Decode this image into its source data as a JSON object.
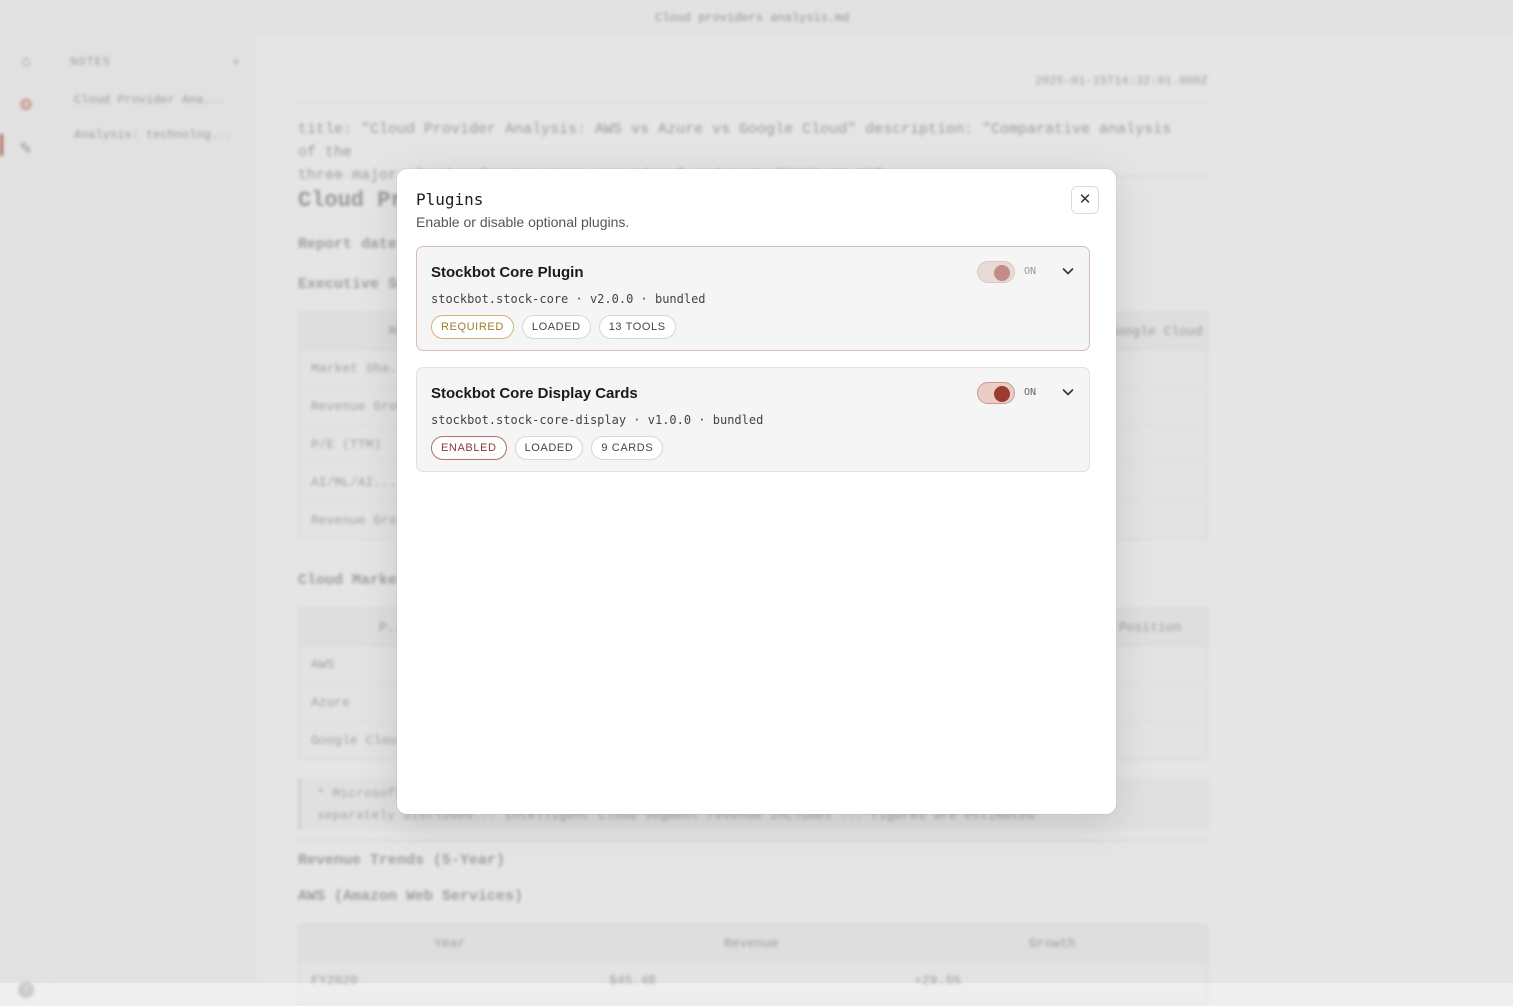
{
  "background": {
    "window_title": "Cloud providers analysis.md",
    "sidebar": {
      "header": "NOTES",
      "add_icon": "plus-icon",
      "items": [
        {
          "label": "Cloud Provider Ana..."
        },
        {
          "label": "Analysis: technolog..."
        }
      ]
    },
    "rail": {
      "icons": [
        "home-icon",
        "gear-icon",
        "wrench-icon"
      ],
      "help_icon": "help-icon"
    },
    "document": {
      "date": "2025-01-15T14:32:01.000Z",
      "meta_lines": [
        "title: \"Cloud Provider Analysis: AWS vs Azure vs Google Cloud\" description: \"Comparative analysis of the",
        "three major cloud infrastructure providers\" updated: \"2025-01-15\""
      ],
      "heading": "Cloud Pr...",
      "report_label": "Report date...",
      "section_exec": "Executive Su...",
      "exec_table": {
        "header_left": "M...",
        "header_right": "Google Cloud",
        "rows": [
          "Market Sha...",
          "Revenue Grow...",
          "P/E (TTM)",
          "AI/ML/AI...",
          "Revenue Gro..."
        ]
      },
      "section_cloud": "Cloud Market...",
      "cloud_table": {
        "header_left": "P...",
        "header_right": "Position",
        "rows": [
          "AWS",
          "Azure",
          "Google Clou..."
        ]
      },
      "note_lines": [
        "* Microsoft ...                                                                        ...s not",
        "separately disclosed... Intelligent Cloud segment revenue includes ... figures are estimated"
      ],
      "section_revenue": "Revenue Trends (5-Year)",
      "subsection_aws": "AWS (Amazon Web Services)",
      "revenue_table": {
        "headers": [
          "Year",
          "Revenue",
          "Growth"
        ],
        "first_row": [
          "FY2020",
          "$45.4B",
          "+29.5%"
        ]
      }
    }
  },
  "modal": {
    "title": "Plugins",
    "subtitle": "Enable or disable optional plugins.",
    "close_icon": "close-icon",
    "plugins": [
      {
        "name": "Stockbot Core Plugin",
        "meta": "stockbot.stock-core · v2.0.0 · bundled",
        "toggle_state": "ON",
        "toggle_locked": true,
        "badges": [
          "REQUIRED",
          "LOADED",
          "13 TOOLS"
        ]
      },
      {
        "name": "Stockbot Core Display Cards",
        "meta": "stockbot.stock-core-display · v1.0.0 · bundled",
        "toggle_state": "ON",
        "toggle_locked": false,
        "badges": [
          "ENABLED",
          "LOADED",
          "9 CARDS"
        ]
      }
    ]
  },
  "colors": {
    "accent": "#9a3b2e",
    "required_badge": "#9d7c2c",
    "enabled_badge": "#8b3b31"
  }
}
